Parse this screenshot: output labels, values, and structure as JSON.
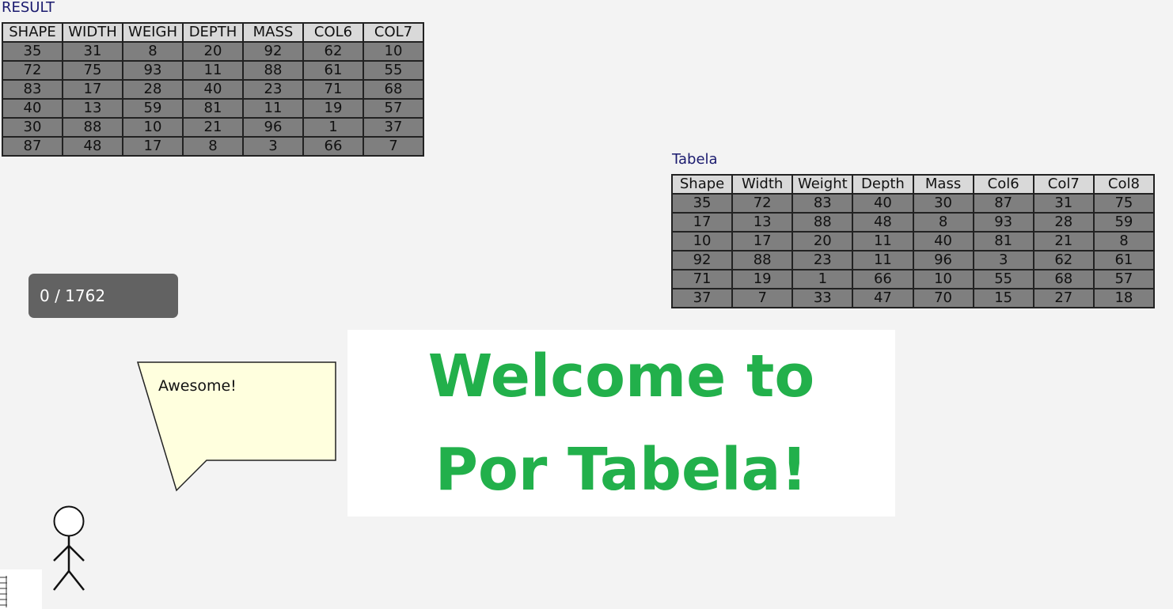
{
  "result": {
    "caption": "RESULT",
    "headers": [
      "SHAPE",
      "WIDTH",
      "WEIGH",
      "DEPTH",
      "MASS",
      "COL6",
      "COL7"
    ],
    "rows": [
      [
        "35",
        "31",
        "8",
        "20",
        "92",
        "62",
        "10"
      ],
      [
        "72",
        "75",
        "93",
        "11",
        "88",
        "61",
        "55"
      ],
      [
        "83",
        "17",
        "28",
        "40",
        "23",
        "71",
        "68"
      ],
      [
        "40",
        "13",
        "59",
        "81",
        "11",
        "19",
        "57"
      ],
      [
        "30",
        "88",
        "10",
        "21",
        "96",
        "1",
        "37"
      ],
      [
        "87",
        "48",
        "17",
        "8",
        "3",
        "66",
        "7"
      ]
    ]
  },
  "tabela": {
    "caption": "Tabela",
    "headers": [
      "Shape",
      "Width",
      "Weight",
      "Depth",
      "Mass",
      "Col6",
      "Col7",
      "Col8"
    ],
    "rows": [
      [
        "35",
        "72",
        "83",
        "40",
        "30",
        "87",
        "31",
        "75"
      ],
      [
        "17",
        "13",
        "88",
        "48",
        "8",
        "93",
        "28",
        "59"
      ],
      [
        "10",
        "17",
        "20",
        "11",
        "40",
        "81",
        "21",
        "8"
      ],
      [
        "92",
        "88",
        "23",
        "11",
        "96",
        "3",
        "62",
        "61"
      ],
      [
        "71",
        "19",
        "1",
        "66",
        "10",
        "55",
        "68",
        "57"
      ],
      [
        "37",
        "7",
        "33",
        "47",
        "70",
        "15",
        "27",
        "18"
      ]
    ]
  },
  "score": {
    "text": "0 / 1762"
  },
  "speech": {
    "text": "Awesome!"
  },
  "welcome": {
    "line1": "Welcome to",
    "line2": "Por Tabela!",
    "color": "#22b04b"
  },
  "icons": {
    "character": "stick-figure-icon",
    "corner": "grid-lines-icon"
  }
}
